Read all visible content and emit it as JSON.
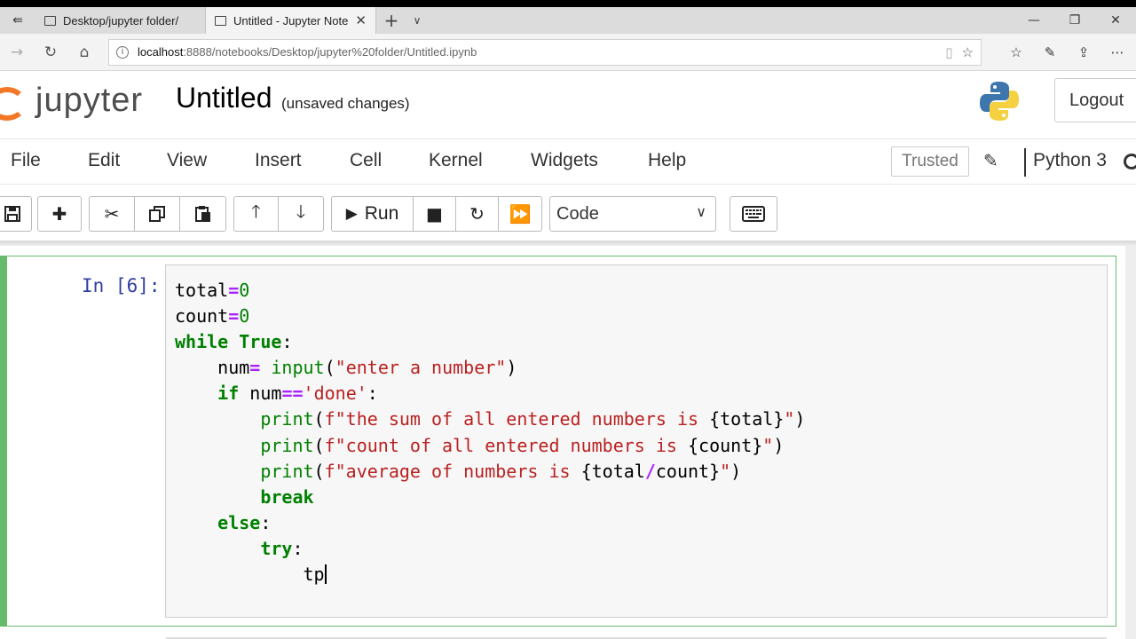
{
  "browser": {
    "tabs": [
      {
        "title": "Desktop/jupyter folder/",
        "active": false
      },
      {
        "title": "Untitled - Jupyter Notel",
        "active": true
      }
    ],
    "url_host": "localhost",
    "url_path": ":8888/notebooks/Desktop/jupyter%20folder/Untitled.ipynb",
    "icons": [
      "set-aside-tabs-icon",
      "back-icon",
      "forward-icon",
      "refresh-icon",
      "home-icon",
      "info-icon",
      "reading-view-icon",
      "favorite-star-icon",
      "favorites-bar-icon",
      "pen-icon",
      "share-icon"
    ]
  },
  "header": {
    "logo_text": "jupyter",
    "notebook_title": "Untitled",
    "save_status": "(unsaved changes)",
    "logout_label": "Logout"
  },
  "menu": {
    "items": [
      "File",
      "Edit",
      "View",
      "Insert",
      "Cell",
      "Kernel",
      "Widgets",
      "Help"
    ],
    "trusted_label": "Trusted",
    "kernel_name": "Python 3"
  },
  "toolbar": {
    "run_label": "Run",
    "cell_type": "Code"
  },
  "cell": {
    "prompt": "In [6]:"
  },
  "colors": {
    "jupyter_orange": "#f37726",
    "cell_selected_border": "#66bb6a",
    "prompt_blue": "#303f9f",
    "keyword_green": "#008000",
    "operator_purple": "#aa22ff",
    "string_red": "#ba2121"
  }
}
